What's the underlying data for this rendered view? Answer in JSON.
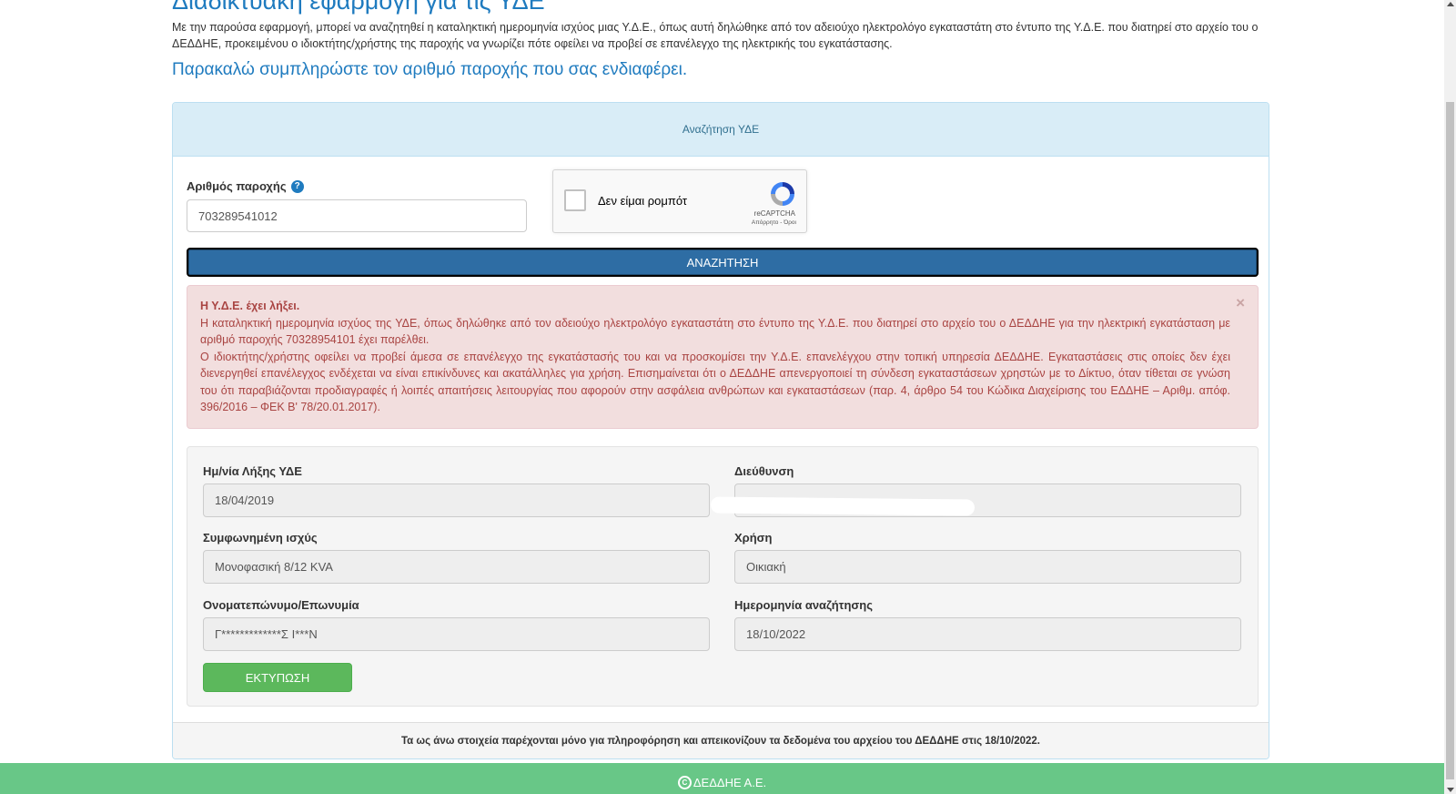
{
  "page": {
    "heading": "Διαδικτυακή εφαρμογή για τις ΥΔΕ",
    "intro": "Με την παρούσα εφαρμογή, μπορεί να αναζητηθεί η καταληκτική ημερομηνία ισχύος μιας Υ.Δ.Ε., όπως αυτή δηλώθηκε από τον αδειούχο ηλεκτρολόγο εγκαταστάτη στο έντυπο της Υ.Δ.Ε. που διατηρεί στο αρχείο του ο ΔΕΔΔΗΕ, προκειμένου ο ιδιοκτήτης/χρήστης της παροχής να γνωρίζει πότε οφείλει να προβεί σε επανέλεγχο της ηλεκτρικής του εγκατάστασης.",
    "subheading": "Παρακαλώ συμπληρώστε τον αριθμό παροχής που σας ενδιαφέρει."
  },
  "panel": {
    "heading": "Αναζήτηση ΥΔΕ"
  },
  "form": {
    "supply_label": "Αριθμός παροχής",
    "help_icon": "?",
    "supply_value": "703289541012",
    "search_label": "ΑΝΑΖΗΤΗΣΗ"
  },
  "captcha": {
    "label": "Δεν είμαι ρομπότ",
    "brand": "reCAPTCHA",
    "links": "Απόρρητο - Όροι"
  },
  "alert": {
    "title": "Η Υ.Δ.Ε. έχει λήξει.",
    "line1": "Η καταληκτική ημερομηνία ισχύος της ΥΔΕ, όπως δηλώθηκε από τον αδειούχο ηλεκτρολόγο εγκαταστάτη στο έντυπο της Υ.Δ.Ε. που διατηρεί στο αρχείο του ο ΔΕΔΔΗΕ για την ηλεκτρική εγκατάσταση με αριθμό παροχής 70328954101 έχει παρέλθει.",
    "line2": "Ο ιδιοκτήτης/χρήστης οφείλει να προβεί άμεσα σε επανέλεγχο της εγκατάστασής του και να προσκομίσει την Υ.Δ.Ε. επανελέγχου στην τοπική υπηρεσία ΔΕΔΔΗΕ. Εγκαταστάσεις στις οποίες δεν έχει διενεργηθεί επανέλεγχος ενδέχεται να είναι επικίνδυνες και ακατάλληλες για χρήση. Επισημαίνεται ότι ο ΔΕΔΔΗΕ απενεργοποιεί τη σύνδεση εγκαταστάσεων χρηστών με το Δίκτυο, όταν τίθεται σε γνώση του ότι παραβιάζονται προδιαγραφές ή λοιπές απαιτήσεις λειτουργίας που αφορούν στην ασφάλεια ανθρώπων και εγκαταστάσεων (παρ. 4, άρθρο 54 του Κώδικα Διαχείρισης του ΕΔΔΗΕ – Αριθμ. απόφ. 396/2016 – ΦΕΚ Β' 78/20.01.2017).",
    "close": "×"
  },
  "results": {
    "expiry_label": "Ημ/νία Λήξης ΥΔΕ",
    "expiry_value": "18/04/2019",
    "address_label": "Διεύθυνση",
    "power_label": "Συμφωνημένη ισχύς",
    "power_value": "Μονοφασική 8/12 KVA",
    "use_label": "Χρήση",
    "use_value": "Οικιακή",
    "name_label": "Ονοματεπώνυμο/Επωνυμία",
    "name_value": "Γ*************Σ Ι***Ν",
    "search_date_label": "Ημερομηνία αναζήτησης",
    "search_date_value": "18/10/2022",
    "print_label": "ΕΚΤΥΠΩΣΗ"
  },
  "panel_footer": "Τα ως άνω στοιχεία παρέχονται μόνο για πληροφόρηση και απεικονίζουν τα δεδομένα του αρχείου του ΔΕΔΔΗΕ στις 18/10/2022.",
  "site_footer": {
    "icon": "C",
    "text": "ΔΕΔΔΗΕ Α.Ε."
  },
  "colors": {
    "accent": "#1f7bbf",
    "search_button": "#2e6da4",
    "print_button": "#5cb85c",
    "alert_bg": "#f2dede",
    "alert_text": "#a94442",
    "footer_bg": "#68c787"
  }
}
